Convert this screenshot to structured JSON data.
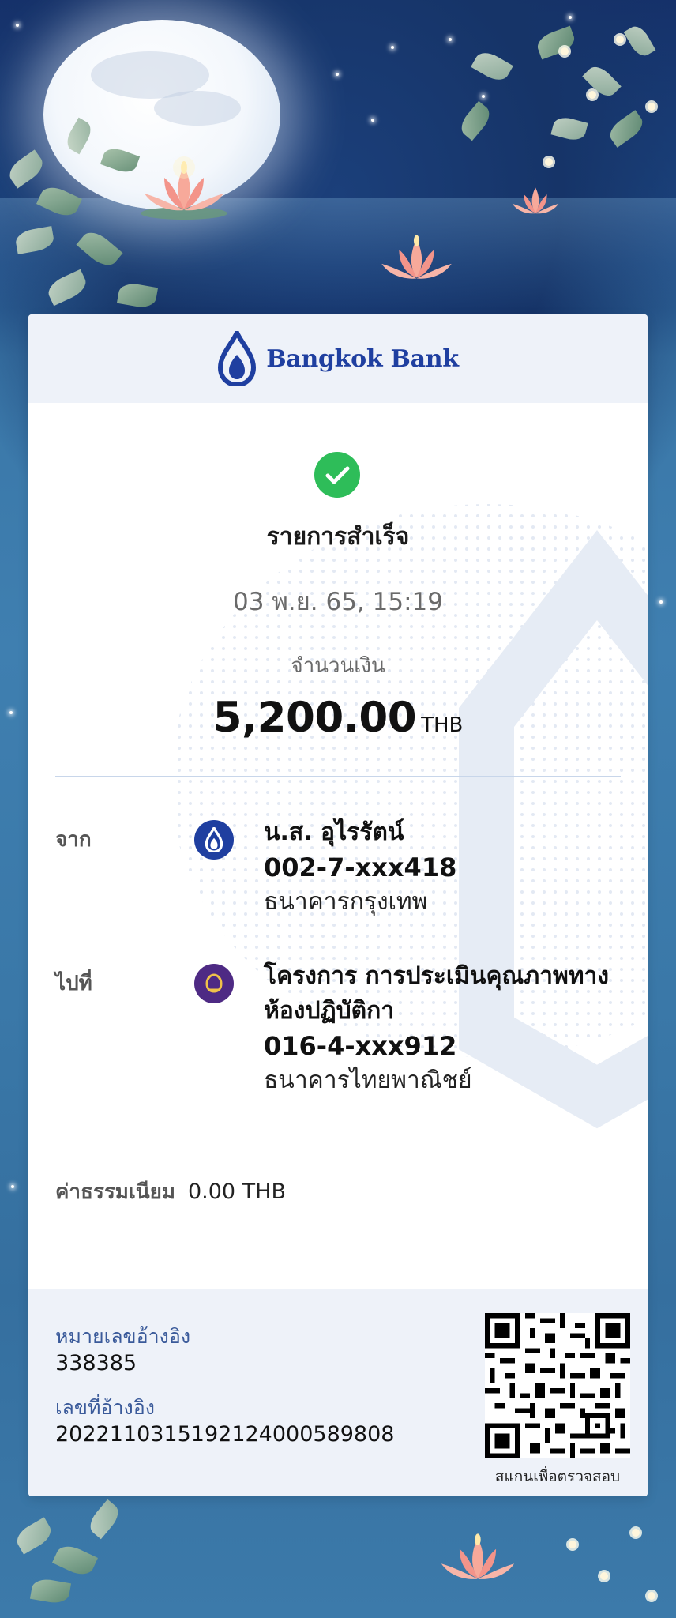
{
  "bank": {
    "name": "Bangkok Bank",
    "brand_color": "#1f3fa0"
  },
  "status": {
    "icon": "check-circle-icon",
    "color": "#2ebd59",
    "text": "รายการสำเร็จ"
  },
  "datetime": "03 พ.ย. 65, 15:19",
  "amount": {
    "label": "จำนวนเงิน",
    "value": "5,200.00",
    "currency": "THB"
  },
  "from": {
    "label": "จาก",
    "icon": "bangkok-bank-icon",
    "icon_color": "#1f3fa0",
    "name": "น.ส. อุไรรัตน์",
    "account": "002-7-xxx418",
    "bank": "ธนาคารกรุงเทพ"
  },
  "to": {
    "label": "ไปที่",
    "icon": "scb-bank-icon",
    "icon_color": "#4e2a84",
    "name_line1": "โครงการ การประเมินคุณภาพทาง",
    "name_line2": "ห้องปฏิบัติกา",
    "account": "016-4-xxx912",
    "bank": "ธนาคารไทยพาณิชย์"
  },
  "fee": {
    "label": "ค่าธรรมเนียม",
    "value": "0.00 THB"
  },
  "reference": {
    "ref_number_label": "หมายเลขอ้างอิง",
    "ref_number": "338385",
    "ref_id_label": "เลขที่อ้างอิง",
    "ref_id": "2022110315192124000589808"
  },
  "qr": {
    "caption": "สแกนเพื่อตรวจสอบ"
  }
}
